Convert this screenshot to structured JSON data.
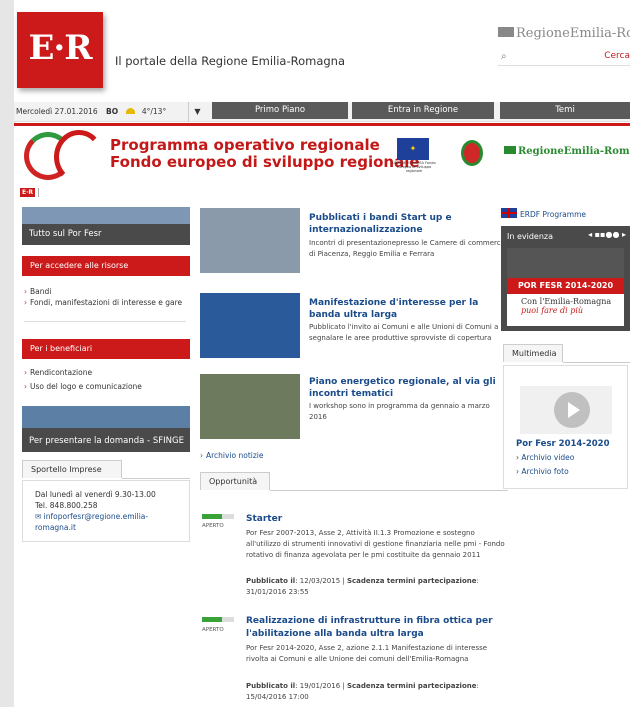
{
  "header": {
    "logo_text": "E·R",
    "tagline": "Il portale della Regione Emilia-Romagna",
    "brand": "RegioneEmilia-Romagna",
    "search_button": "Cerca"
  },
  "infobar": {
    "date": "Mercoledì 27.01.2016",
    "city": "BO",
    "temperature": "4°/13°"
  },
  "nav": [
    "Primo Piano",
    "Entra in Regione",
    "Temi"
  ],
  "banner": {
    "title_line1": "Programma operativo regionale",
    "title_line2": "Fondo europeo di sviluppo regionale",
    "eu_caption": "UNIONE EUROPEA Fondo europeo di sviluppo regionale",
    "brand": "RegioneEmilia-Romagna"
  },
  "mini_logo": "E·R",
  "left": {
    "tutto_label": "Tutto sul Por Fesr",
    "accedere_title": "Per accedere alle risorse",
    "accedere_links": [
      "Bandi",
      "Fondi, manifestazioni di interesse e gare"
    ],
    "beneficiari_title": "Per i beneficiari",
    "beneficiari_links": [
      "Rendicontazione",
      "Uso del logo e comunicazione"
    ],
    "domanda_label": "Per presentare la domanda - SFINGE",
    "sportello_tab": "Sportello Imprese",
    "contact": {
      "hours": "Dal lunedì al venerdì 9.30-13.00",
      "phone": "Tel. 848.800.258",
      "email": "infoporfesr@regione.emilia-romagna.it"
    }
  },
  "news": [
    {
      "title": "Pubblicati i bandi Start up e internazionalizzazione",
      "desc": "Incontri di presentazionepresso le Camere di commercio di Piacenza, Reggio Emilia e Ferrara"
    },
    {
      "title": "Manifestazione d'interesse per la banda ultra larga",
      "desc": "Pubblicato l'invito ai Comuni e alle Unioni di Comuni a segnalare le aree produttive sprovviste di copertura"
    },
    {
      "title": "Piano energetico regionale, al via gli incontri tematici",
      "desc": "I workshop sono in programma da gennaio a marzo 2016"
    }
  ],
  "archivio": "Archivio notizie",
  "opportunita": {
    "tab": "Opportunità",
    "items": [
      {
        "status": "APERTO",
        "title": "Starter",
        "desc": "Por Fesr 2007-2013, Asse 2, Attività II.1.3 Promozione e sostegno all'utilizzo di strumenti innovativi di gestione finanziaria nelle pmi - Fondo rotativo di finanza agevolata per le pmi costituite da gennaio 2011",
        "pub_label": "Pubblicato il",
        "pub_date": "12/03/2015",
        "deadline_label": "Scadenza termini partecipazione",
        "deadline": "31/01/2016 23:55"
      },
      {
        "status": "APERTO",
        "title": "Realizzazione di infrastrutture in fibra ottica per l'abilitazione alla banda ultra larga",
        "desc": "Por Fesr 2014-2020, Asse 2, azione 2.1.1 Manifestazione di interesse rivolta ai Comuni e alle Unione dei comuni dell'Emilia-Romagna",
        "pub_label": "Pubblicato il",
        "pub_date": "19/01/2016",
        "deadline_label": "Scadenza termini partecipazione",
        "deadline": "15/04/2016 17:00"
      }
    ]
  },
  "right": {
    "erdf_link": "ERDF Programme",
    "evidenza_label": "In evidenza",
    "evidenza_banner": "POR FESR 2014-2020",
    "evidenza_brand_l1": "Con l'Emilia-Romagna",
    "evidenza_brand_l2": "puoi fare di più",
    "multimedia_tab": "Multimedia",
    "multimedia_title": "Por Fesr 2014-2020",
    "multimedia_links": [
      "Archivio video",
      "Archivio foto"
    ]
  }
}
